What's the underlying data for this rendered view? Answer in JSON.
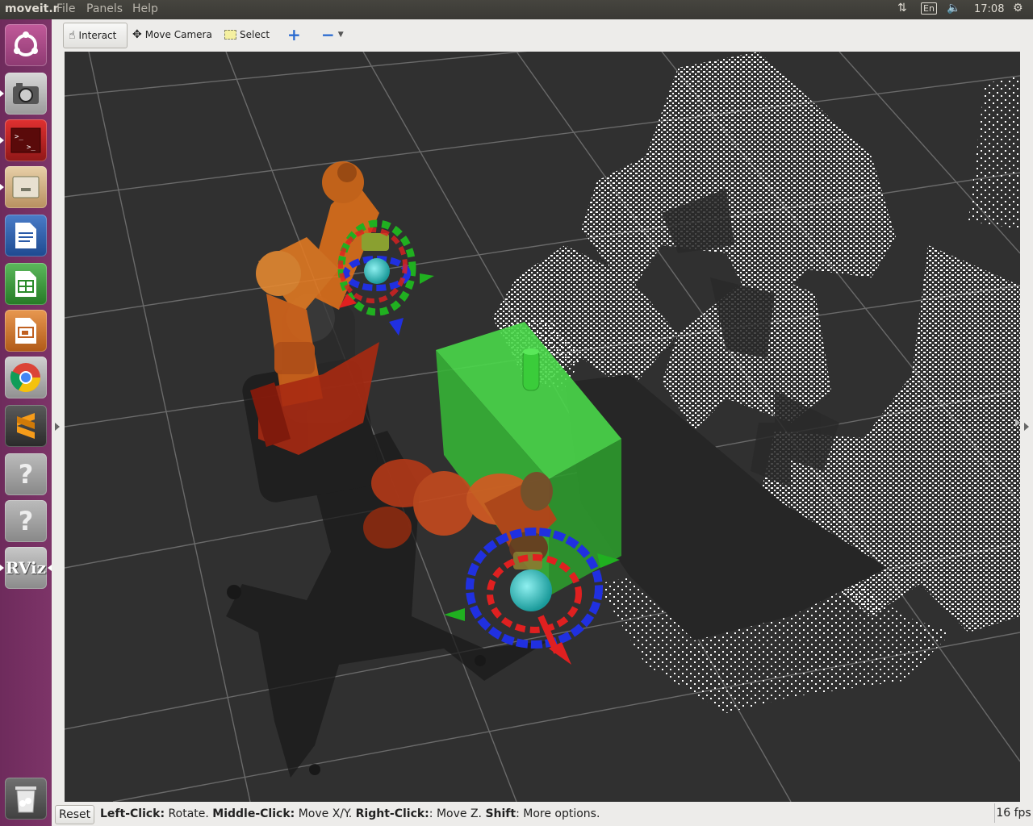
{
  "topbar": {
    "app_title": "moveit.r",
    "menus": [
      "File",
      "Panels",
      "Help"
    ],
    "keyboard_layout": "En",
    "clock": "17:08"
  },
  "launcher": {
    "items": [
      "ubuntu-dash",
      "camera-app",
      "terminal-app",
      "file-manager",
      "writer-app",
      "calc-app",
      "impress-app",
      "chrome-app",
      "sublime-app",
      "unknown-app-1",
      "unknown-app-2",
      "rviz-app",
      "trash"
    ],
    "rviz_label": "RViz",
    "unknown_label": "?"
  },
  "toolbar": {
    "interact": "Interact",
    "move_camera": "Move Camera",
    "select": "Select",
    "add_tool": "+",
    "remove_tool": "−"
  },
  "status": {
    "reset": "Reset",
    "left_click_key": "Left-Click:",
    "left_click_val": " Rotate. ",
    "middle_click_key": "Middle-Click:",
    "middle_click_val": " Move X/Y. ",
    "right_click_key": "Right-Click:",
    "right_click_val": ": Move Z. ",
    "shift_key": "Shift",
    "shift_val": ": More options.",
    "fps": "16 fps"
  },
  "colors": {
    "viewport_bg": "#303030",
    "grid": "#6a6a6a",
    "box": "#3cc83c",
    "robot_orange": "#e0701a",
    "robot_red": "#b02a10",
    "marker_red": "#e02020",
    "marker_green": "#20b020",
    "marker_blue": "#2030e0",
    "cloud": "#ffffff"
  }
}
